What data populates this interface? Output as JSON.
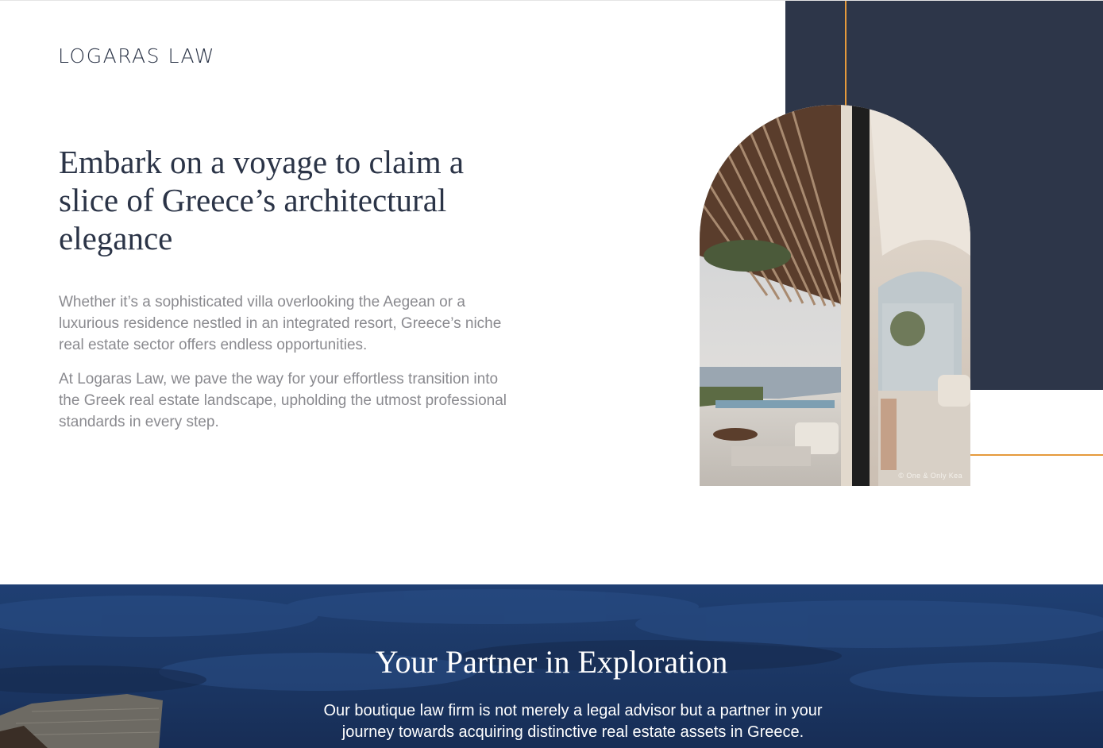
{
  "brand": {
    "logo_text": "Logaras Law"
  },
  "hero": {
    "title": "Embark on a voyage to claim a slice of Greece’s architectural elegance",
    "paragraphs": [
      "Whether it’s a sophisticated villa overlooking the Aegean or a luxurious residence nestled in an integrated resort, Greece’s niche real estate sector offers endless opportunities.",
      "At Logaras Law, we pave the way for your effortless transition into the Greek real estate landscape, upholding the utmost professional standards in every step."
    ],
    "image_caption": "© One & Only Kea"
  },
  "partner": {
    "title": "Your Partner in Exploration",
    "body": "Our boutique law firm is not merely a legal advisor but a partner in your journey towards acquiring distinctive real estate assets in Greece."
  },
  "colors": {
    "navy": "#2d3649",
    "accent_orange": "#e59a3c",
    "text_dark": "#2b3447",
    "text_muted": "#8a8a8f",
    "band_blue": "#1d3a69"
  }
}
